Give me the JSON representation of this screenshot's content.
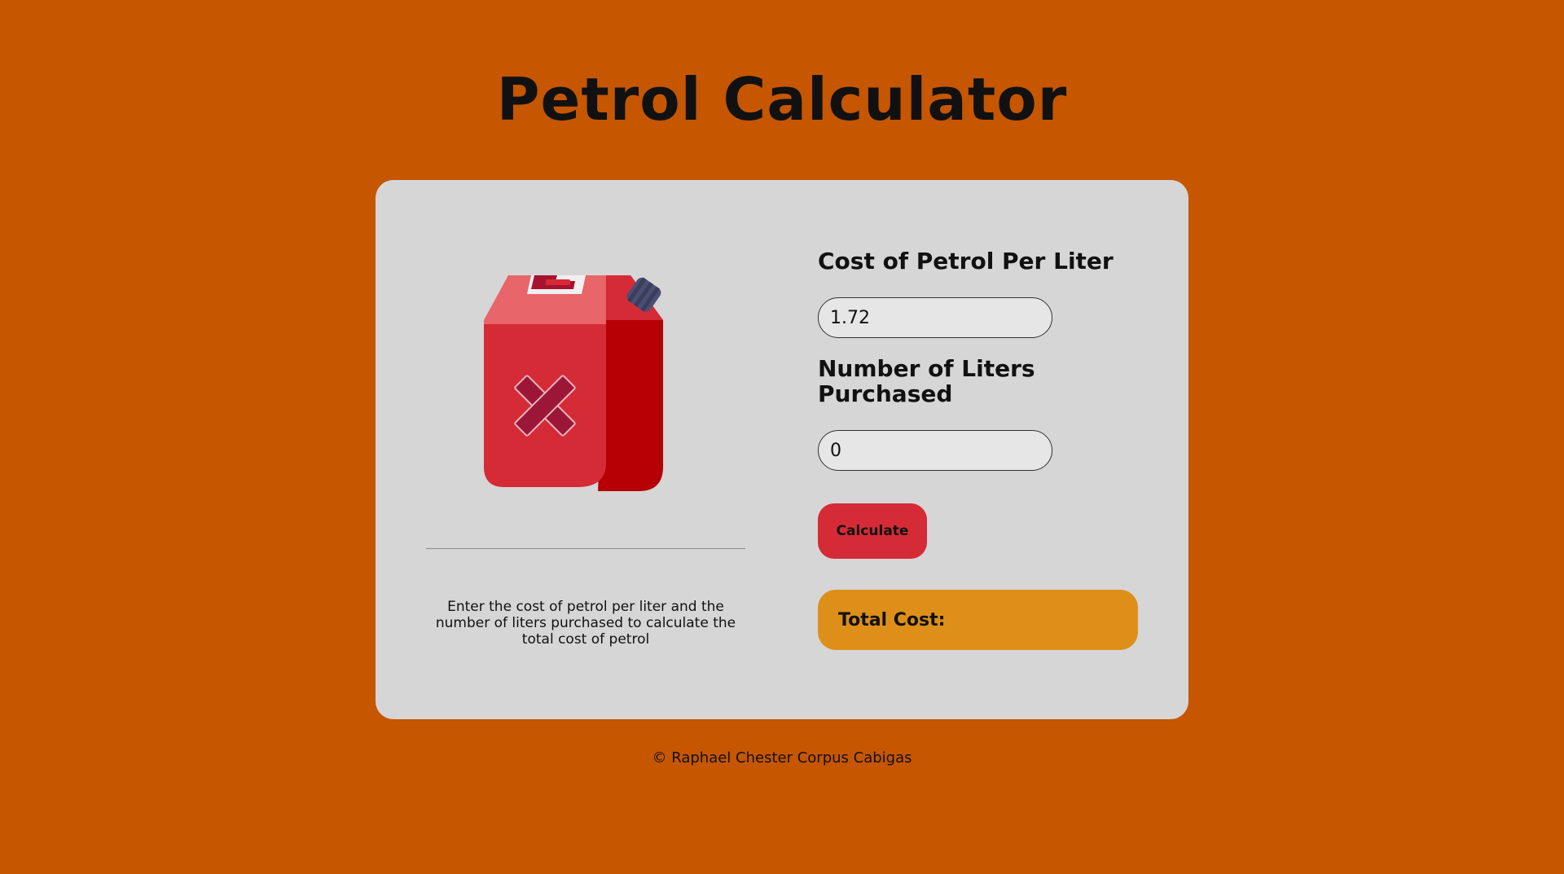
{
  "page": {
    "title": "Petrol Calculator"
  },
  "illustration": {
    "icon": "petrol-jerrycan-icon"
  },
  "info": {
    "description": "Enter the cost of petrol per liter and the number of liters purchased to calculate the total cost of petrol"
  },
  "form": {
    "cost_label": "Cost of Petrol Per Liter",
    "cost_value": "1.72",
    "liters_label": "Number of Liters Purchased",
    "liters_value": "0",
    "calculate_label": "Calculate",
    "total_label": "Total Cost:",
    "total_value": ""
  },
  "footer": {
    "text": "© Raphael Chester Corpus Cabigas"
  },
  "colors": {
    "background": "#c65600",
    "card": "#d6d6d6",
    "button": "#d52b36",
    "total_box": "#dd8f19",
    "input_background": "#e6e6e6"
  }
}
